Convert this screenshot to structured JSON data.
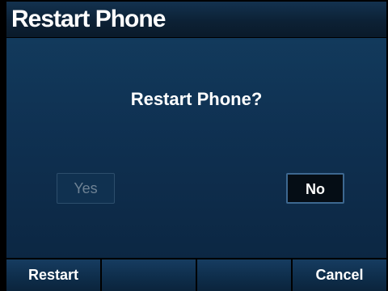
{
  "window": {
    "title": "Restart Phone"
  },
  "dialog": {
    "question": "Restart Phone?",
    "yes_label": "Yes",
    "no_label": "No"
  },
  "softkeys": [
    {
      "label": "Restart"
    },
    {
      "label": ""
    },
    {
      "label": ""
    },
    {
      "label": "Cancel"
    }
  ],
  "colors": {
    "panel": "#0f3152",
    "title_bar": "#0c2135",
    "softkey": "#0e2d4a",
    "focus_border": "#3d6890",
    "disabled_text": "#6e8294"
  }
}
